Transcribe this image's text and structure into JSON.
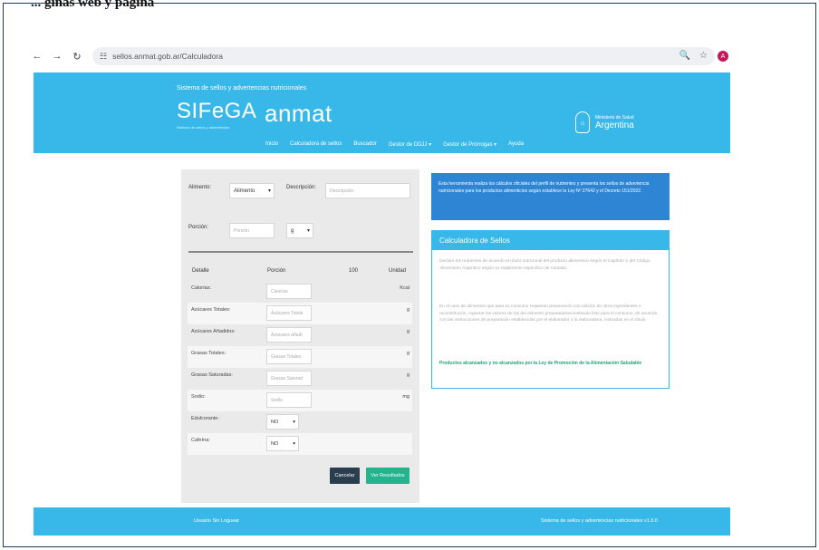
{
  "caption_cut": "... ginas web y pagina",
  "browser": {
    "url": "sellos.anmat.gob.ar/Calculadora",
    "back": "←",
    "forward": "→",
    "reload": "↻",
    "site_info": "☷",
    "zoom": "🔍",
    "star": "☆",
    "avatar": "A"
  },
  "header": {
    "tagline": "Sistema de sellos y advertencias nutricionales",
    "logo": "SIFeGA",
    "logo_sub": "Sistema de sellos y advertencias",
    "anmat": "anmat",
    "nav": [
      "Inicio",
      "Calculadora de sellos",
      "Buscador",
      "Gestor de DDJJ ▾",
      "Gestor de Prórrogas ▾",
      "Ayuda"
    ],
    "ministry_small": "Ministerio de Salud",
    "ministry_big": "Argentina",
    "seal": "☼"
  },
  "form": {
    "alimento_label": "Alimento:",
    "alimento_value": "Alimento",
    "descripcion_label": "Descripción:",
    "descripcion_placeholder": "Descripción",
    "porcion_label": "Porción:",
    "porcion_placeholder": "Porción",
    "unidad_value": "g",
    "caret": "▾",
    "headers": [
      "Detalle",
      "Porción",
      "100",
      "Unidad"
    ],
    "rows": [
      {
        "label": "Calorías:",
        "placeholder": "Calorías",
        "unit": "Kcal"
      },
      {
        "label": "Azúcares Totales:",
        "placeholder": "Azúcares Totale",
        "unit": "g"
      },
      {
        "label": "Azúcares Añadidos:",
        "placeholder": "Azúcares añadi",
        "unit": "g"
      },
      {
        "label": "Grasas Totales:",
        "placeholder": "Grasas Totales",
        "unit": "g"
      },
      {
        "label": "Grasas Saturadas:",
        "placeholder": "Grasas Saturad",
        "unit": "g"
      },
      {
        "label": "Sodio:",
        "placeholder": "Sodio",
        "unit": "mg"
      }
    ],
    "edulcorante_label": "Edulcorante:",
    "edulcorante_value": "NO",
    "cafeina_label": "Cafeína:",
    "cafeina_value": "NO",
    "cancel_label": "Cancelar",
    "result_label": "Ver Resultados"
  },
  "info": {
    "text": "Esta herramienta realiza los cálculos oficiales del perfil de nutrientes y presenta los sellos de advertencia nutricionales para los productos alimenticios según establece la Ley Nº 27642 y el Decreto 151/2022.",
    "card_title": "Calculadora de Sellos",
    "p1": "Declare los nutrientes de acuerdo al rótulo nutricional del producto alimenticio según el Capítulo V del Código Alimentario Argentino según su reglamento específico de rotulado.",
    "p2": "En el caso de alimentos que para su consumo requieran preparación con adición de otros ingredientes o reconstitución, ingresar los valores de los del alimento preparado/reconstituido listo para el consumo, de acuerdo con las instrucciones de preparación establecidas por el elaborador o la elaboradora, indicadas en el rótulo.",
    "link": "Productos alcanzados y no alcanzados por la Ley de Promoción de la Alimentación Saludable"
  },
  "footer": {
    "left": "Usuario Sin Loguear",
    "right": "Sistema de sellos y advertencias nutricionales v1.0.0"
  }
}
